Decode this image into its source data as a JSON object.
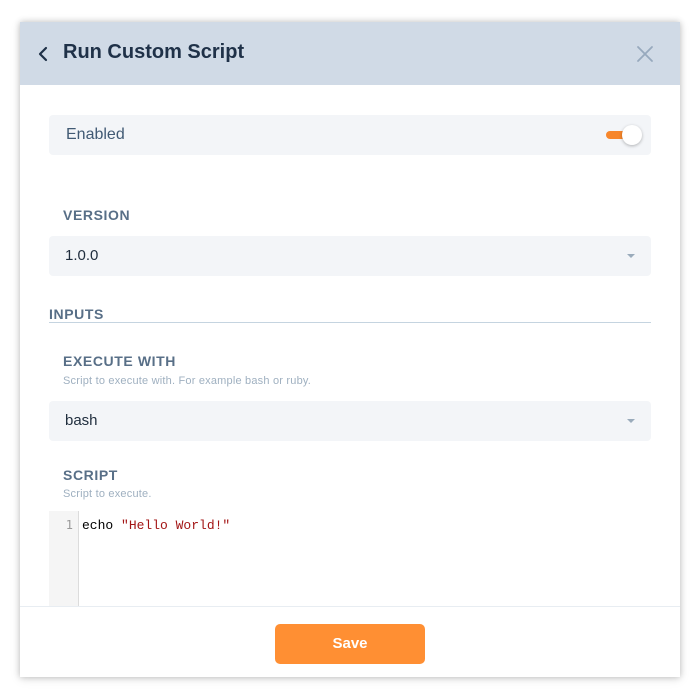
{
  "header": {
    "title": "Run Custom Script",
    "back_icon": "chevron-left-icon",
    "close_icon": "close-icon"
  },
  "enabled": {
    "label": "Enabled",
    "toggle_on": true,
    "accent_color": "#f7862b"
  },
  "version": {
    "label": "VERSION",
    "selected": "1.0.0"
  },
  "inputs": {
    "heading": "INPUTS",
    "execute_with": {
      "label": "EXECUTE WITH",
      "hint": "Script to execute with. For example bash or ruby.",
      "selected": "bash"
    },
    "script": {
      "label": "SCRIPT",
      "hint": "Script to execute.",
      "line_number": "1",
      "code_keyword": "echo ",
      "code_string": "\"Hello World!\""
    }
  },
  "footer": {
    "save_label": "Save",
    "save_color": "#ff8f33"
  },
  "colors": {
    "header_bg": "#d0dae6",
    "field_bg": "#f3f5f8",
    "label": "#586f87"
  }
}
